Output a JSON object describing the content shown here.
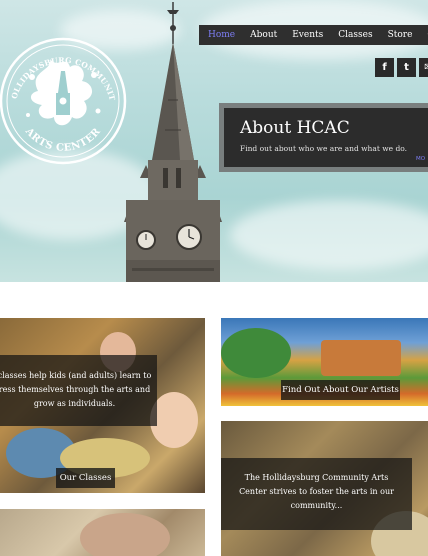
{
  "logo": {
    "arc_top": "HOLLIDAYSBURG COMMUNITY",
    "arc_bottom": "ARTS CENTER"
  },
  "nav": {
    "items": [
      "Home",
      "About",
      "Events",
      "Classes",
      "Store",
      "Co"
    ],
    "active": "Home"
  },
  "social": {
    "items": [
      {
        "icon": "facebook-icon",
        "glyph": "f"
      },
      {
        "icon": "twitter-icon",
        "glyph": "t"
      },
      {
        "icon": "email-icon",
        "glyph": "✉"
      }
    ]
  },
  "about": {
    "title": "About HCAC",
    "subtitle": "Find out about who we are and what we do.",
    "more": "MO"
  },
  "tiles": {
    "classes_text_line1": "classes help kids (and adults) learn to",
    "classes_text_line2": "ress themselves through the arts and",
    "classes_text_line3": "grow as individuals.",
    "classes_button": "Our Classes",
    "artists_button": "Find Out About Our Artists",
    "community_line1": "The Hollidaysburg Community Arts",
    "community_line2": "Center strives to foster the arts in our",
    "community_line3": "community..."
  },
  "colors": {
    "nav_bg": "#2f2f2f",
    "nav_active": "#7d7ef5",
    "overlay": "#141414"
  }
}
